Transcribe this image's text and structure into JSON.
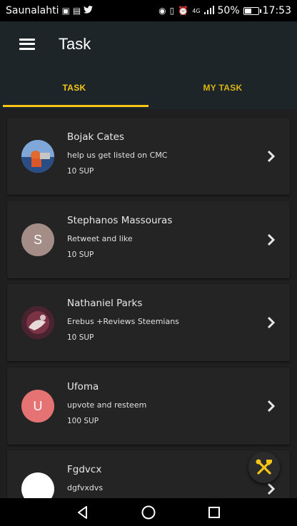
{
  "status_bar": {
    "carrier": "Saunalahti",
    "battery": "50%",
    "battery_level": 0.5,
    "time": "17:53",
    "network": "4G"
  },
  "app_bar": {
    "title": "Task",
    "menu_icon": "hamburger-menu-icon"
  },
  "tabs": [
    {
      "label": "TASK",
      "active": true
    },
    {
      "label": "MY TASK",
      "active": false
    }
  ],
  "tasks": [
    {
      "name": "Bojak Cates",
      "description": "help us get listed on CMC",
      "reward": "10 SUP",
      "avatar": "photo",
      "initial": ""
    },
    {
      "name": "Stephanos Massouras",
      "description": "Retweet and like",
      "reward": "10 SUP",
      "avatar": "letter",
      "initial": "S",
      "avatar_color": "#a38d86"
    },
    {
      "name": "Nathaniel Parks",
      "description": "Erebus +Reviews Steemians",
      "reward": "10 SUP",
      "avatar": "photo",
      "initial": ""
    },
    {
      "name": "Ufoma",
      "description": "upvote and resteem",
      "reward": "100 SUP",
      "avatar": "letter",
      "initial": "U",
      "avatar_color": "#e57373"
    },
    {
      "name": "Fgdvcx",
      "description": "dgfvxdvs",
      "reward": "",
      "avatar": "letter",
      "initial": "",
      "avatar_color": "#ffffff"
    }
  ],
  "fab": {
    "icon": "tools-icon"
  },
  "colors": {
    "accent": "#f5c518",
    "app_bar": "#1d2528",
    "background": "#1f1f1f",
    "card": "#242424"
  }
}
